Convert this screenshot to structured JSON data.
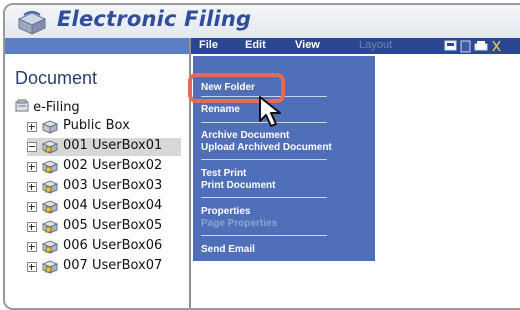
{
  "app": {
    "title": "Electronic Filing"
  },
  "menubar": {
    "items": [
      {
        "label": "File",
        "enabled": true
      },
      {
        "label": "Edit",
        "enabled": true
      },
      {
        "label": "View",
        "enabled": true
      },
      {
        "label": "Layout",
        "enabled": false
      }
    ],
    "tool_icons": [
      "window-icon",
      "document-icon",
      "print-icon",
      "scissors-icon"
    ]
  },
  "left_panel": {
    "heading": "Document",
    "root": "e-Filing",
    "tree": [
      {
        "label": "Public Box",
        "expanded": false,
        "selected": false,
        "icon": "public-box-icon"
      },
      {
        "label": "001 UserBox01",
        "expanded": true,
        "selected": true,
        "icon": "locked-box-icon"
      },
      {
        "label": "002 UserBox02",
        "expanded": false,
        "selected": false,
        "icon": "locked-box-icon"
      },
      {
        "label": "003 UserBox03",
        "expanded": false,
        "selected": false,
        "icon": "locked-box-icon"
      },
      {
        "label": "004 UserBox04",
        "expanded": false,
        "selected": false,
        "icon": "locked-box-icon"
      },
      {
        "label": "005 UserBox05",
        "expanded": false,
        "selected": false,
        "icon": "locked-box-icon"
      },
      {
        "label": "006 UserBox06",
        "expanded": false,
        "selected": false,
        "icon": "locked-box-icon"
      },
      {
        "label": "007 UserBox07",
        "expanded": false,
        "selected": false,
        "icon": "locked-box-icon"
      }
    ]
  },
  "file_menu": {
    "items": [
      {
        "label": "New Folder",
        "enabled": true
      },
      {
        "label": "Rename",
        "enabled": true
      },
      {
        "label": "Archive Document",
        "enabled": true
      },
      {
        "label": "Upload Archived Document",
        "enabled": true
      },
      {
        "label": "Test Print",
        "enabled": true
      },
      {
        "label": "Print Document",
        "enabled": true
      },
      {
        "label": "Properties",
        "enabled": true
      },
      {
        "label": "Page Properties",
        "enabled": false
      },
      {
        "label": "Send Email",
        "enabled": true
      }
    ]
  },
  "colors": {
    "menubar_bg": "#2a478f",
    "dropdown_bg": "#4f6fb8",
    "highlight": "#e46a5a",
    "title": "#2f4f9a"
  }
}
